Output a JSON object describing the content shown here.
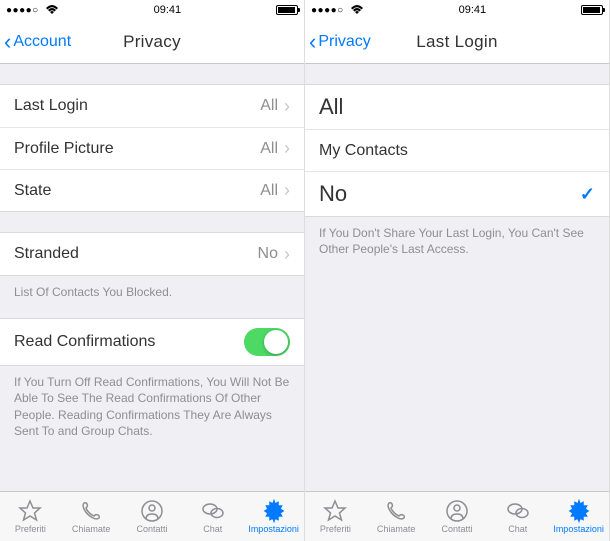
{
  "time": "09:41",
  "signal": "●●●●○",
  "colors": {
    "accent": "#007aff",
    "switch_on": "#4cd964"
  },
  "left": {
    "back": "Account",
    "title": "Privacy",
    "rows": {
      "last_login": {
        "label": "Last Login",
        "value": "All"
      },
      "profile_picture": {
        "label": "Profile Picture",
        "value": "All"
      },
      "state": {
        "label": "State",
        "value": "All"
      },
      "stranded": {
        "label": "Stranded",
        "value": "No"
      },
      "read_confirmations": {
        "label": "Read Confirmations"
      }
    },
    "footers": {
      "blocked": "List Of Contacts You Blocked.",
      "read": "If You Turn Off Read Confirmations, You Will Not Be Able To See The Read Confirmations Of Other People. Reading Confirmations They Are Always Sent To and Group Chats."
    }
  },
  "right": {
    "back": "Privacy",
    "title": "Last Login",
    "rows": {
      "all": "All",
      "my_contacts": "My Contacts",
      "no": "No"
    },
    "footer": "If You Don't Share Your Last Login, You Can't See Other People's Last Access."
  },
  "tabs": {
    "preferiti": "Preferiti",
    "chiamate": "Chiamate",
    "contatti": "Contatti",
    "chat": "Chat",
    "impostazioni": "Impostazioni"
  }
}
